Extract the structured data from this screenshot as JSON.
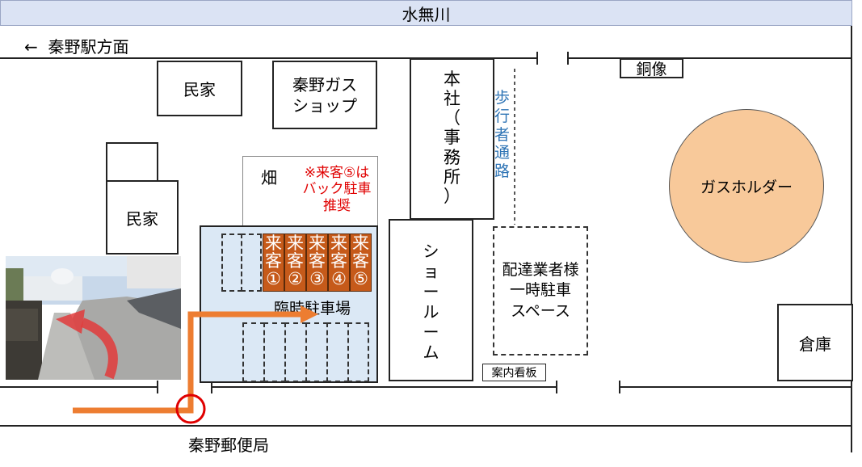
{
  "map": {
    "river": "水無川",
    "direction": "←  秦野駅方面",
    "post_office": "秦野郵便局",
    "buildings": {
      "house1": "民家",
      "gas_shop_line1": "秦野ガス",
      "gas_shop_line2": "ショップ",
      "head_office_chars": [
        "本",
        "社",
        "（",
        "事",
        "務",
        "所",
        "）"
      ],
      "statue": "銅像",
      "field": "畑",
      "house2": "民家",
      "showroom_chars": [
        "シ",
        "ョ",
        "ー",
        "ル",
        "ー",
        "ム"
      ],
      "warehouse": "倉庫",
      "gas_holder": "ガスホルダー"
    },
    "notice": {
      "line1": "※来客⑤は",
      "line2": "バック駐車",
      "line3": "推奨"
    },
    "pedestrian_path_chars": [
      "歩",
      "行",
      "者",
      "通",
      "路"
    ],
    "parking": {
      "label": "臨時駐車場",
      "guest_slots": [
        {
          "line1": "来",
          "line2": "客",
          "line3": "①"
        },
        {
          "line1": "来",
          "line2": "客",
          "line3": "②"
        },
        {
          "line1": "来",
          "line2": "客",
          "line3": "③"
        },
        {
          "line1": "来",
          "line2": "客",
          "line3": "④"
        },
        {
          "line1": "来",
          "line2": "客",
          "line3": "⑤"
        }
      ]
    },
    "delivery": {
      "line1": "配達業者様",
      "line2": "一時駐車",
      "line3": "スペース"
    },
    "sign": "案内看板",
    "colors": {
      "river": "#dbe3f4",
      "parking_lot": "#dbe8f5",
      "guest_slot": "#c65a1a",
      "route_arrow": "#ed7d31",
      "gas_holder": "#f8c99a",
      "notice_text": "#e00000",
      "pedestrian_text": "#2e74b5",
      "entrance_circle": "#e00000"
    }
  }
}
